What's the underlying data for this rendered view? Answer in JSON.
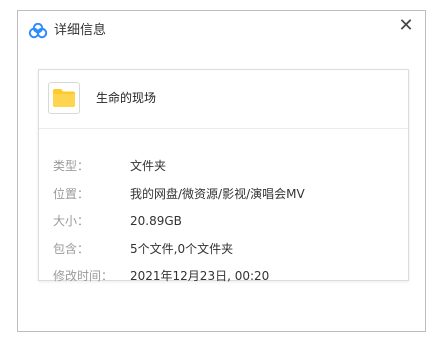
{
  "window": {
    "title": "详细信息",
    "close_glyph": "✕",
    "app_icon": "baidu-netdisk-cloud-icon",
    "close_icon": "close-icon"
  },
  "item": {
    "name": "生命的现场",
    "icon": "folder-icon",
    "icon_color": "#ffca28"
  },
  "details": [
    {
      "label": "类型：",
      "value": "文件夹"
    },
    {
      "label": "位置：",
      "value": "我的网盘/微资源/影视/演唱会MV"
    },
    {
      "label": "大小：",
      "value": "20.89GB"
    },
    {
      "label": "包含：",
      "value": "5个文件,0个文件夹"
    },
    {
      "label": "修改时间：",
      "value": "2021年12月23日, 00:20"
    }
  ],
  "colors": {
    "label": "#9a9a9a",
    "value": "#333333",
    "accent_blue": "#2f8cff"
  }
}
